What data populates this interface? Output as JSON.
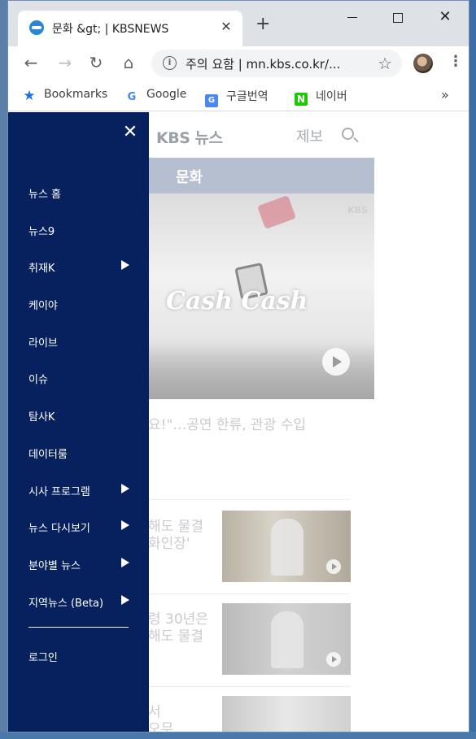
{
  "browser": {
    "tab_title": "문화 &gt; | KBSNEWS",
    "tab_close": "✕",
    "new_tab": "+",
    "address_security": "주의 요함",
    "address_url": "mn.kbs.co.kr/...",
    "address_text": "주의 요함 | mn.kbs.co.kr/..."
  },
  "bookmarks": [
    {
      "label": "Bookmarks",
      "icon": "star-icon"
    },
    {
      "label": "Google",
      "icon": "google-icon"
    },
    {
      "label": "구글번역",
      "icon": "google-translate-icon"
    },
    {
      "label": "네이버",
      "icon": "naver-icon"
    }
  ],
  "bookmarks_more": "»",
  "site": {
    "logo": "KBS 뉴스",
    "report_link": "제보",
    "section_title": "문화",
    "hero_watermark": "KBS",
    "hero_overlay": "Cash Cash",
    "headline": "요!\"…공연 한류, 관광 수입",
    "articles": [
      {
        "text_line1": "해도 물결",
        "text_line2": "화인장'"
      },
      {
        "text_line1": "령 30년은",
        "text_line2": "해도 물결"
      },
      {
        "text_line1": "서",
        "text_line2": "오무"
      }
    ]
  },
  "drawer": {
    "close": "✕",
    "items": [
      {
        "label": "뉴스 홈",
        "has_submenu": false
      },
      {
        "label": "뉴스9",
        "has_submenu": false
      },
      {
        "label": "취재K",
        "has_submenu": true
      },
      {
        "label": "케이야",
        "has_submenu": false
      },
      {
        "label": "라이브",
        "has_submenu": false
      },
      {
        "label": "이슈",
        "has_submenu": false
      },
      {
        "label": "탐사K",
        "has_submenu": false
      },
      {
        "label": "데이터룸",
        "has_submenu": false
      },
      {
        "label": "시사 프로그램",
        "has_submenu": true
      },
      {
        "label": "뉴스 다시보기",
        "has_submenu": true
      },
      {
        "label": "분야별 뉴스",
        "has_submenu": true
      },
      {
        "label": "지역뉴스 (Beta)",
        "has_submenu": true
      }
    ],
    "login": "로그인"
  },
  "colors": {
    "drawer_bg": "#07215e",
    "section_bar": "#b5bfcf",
    "chrome_frame": "#dee1e6"
  }
}
